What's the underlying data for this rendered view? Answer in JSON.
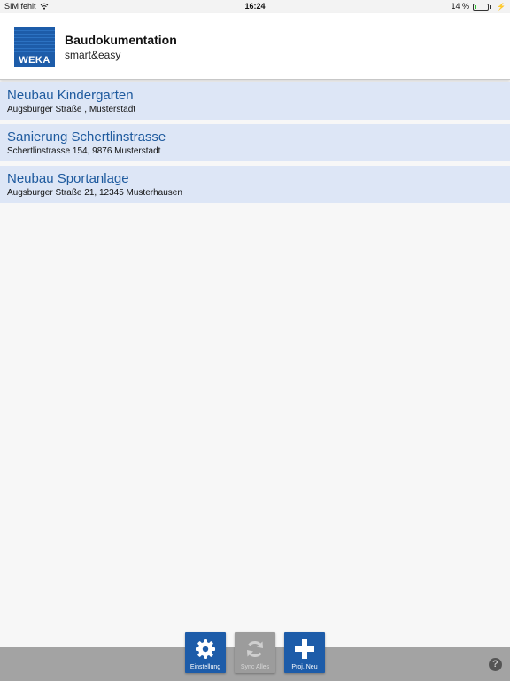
{
  "status_bar": {
    "carrier": "SIM fehlt",
    "time": "16:24",
    "battery_text": "14 %",
    "battery_level": 0.14
  },
  "header": {
    "logo_text": "WEKA",
    "title": "Baudokumentation",
    "subtitle": "smart&easy"
  },
  "projects": [
    {
      "name": "Neubau Kindergarten",
      "address": "Augsburger Straße , Musterstadt"
    },
    {
      "name": "Sanierung Schertlinstrasse",
      "address": "Schertlinstrasse 154, 9876 Musterstadt"
    },
    {
      "name": "Neubau Sportanlage",
      "address": "Augsburger Straße 21, 12345 Musterhausen"
    }
  ],
  "toolbar": {
    "settings_label": "Einstellung",
    "sync_label": "Sync Alles",
    "new_project_label": "Proj. Neu",
    "help_label": "?"
  },
  "colors": {
    "accent": "#1d5ca9",
    "list_item_bg": "#dde6f6",
    "project_name": "#1e5a9e",
    "toolbar_bg": "#a3a3a3",
    "disabled_button": "#9c9c9c"
  }
}
